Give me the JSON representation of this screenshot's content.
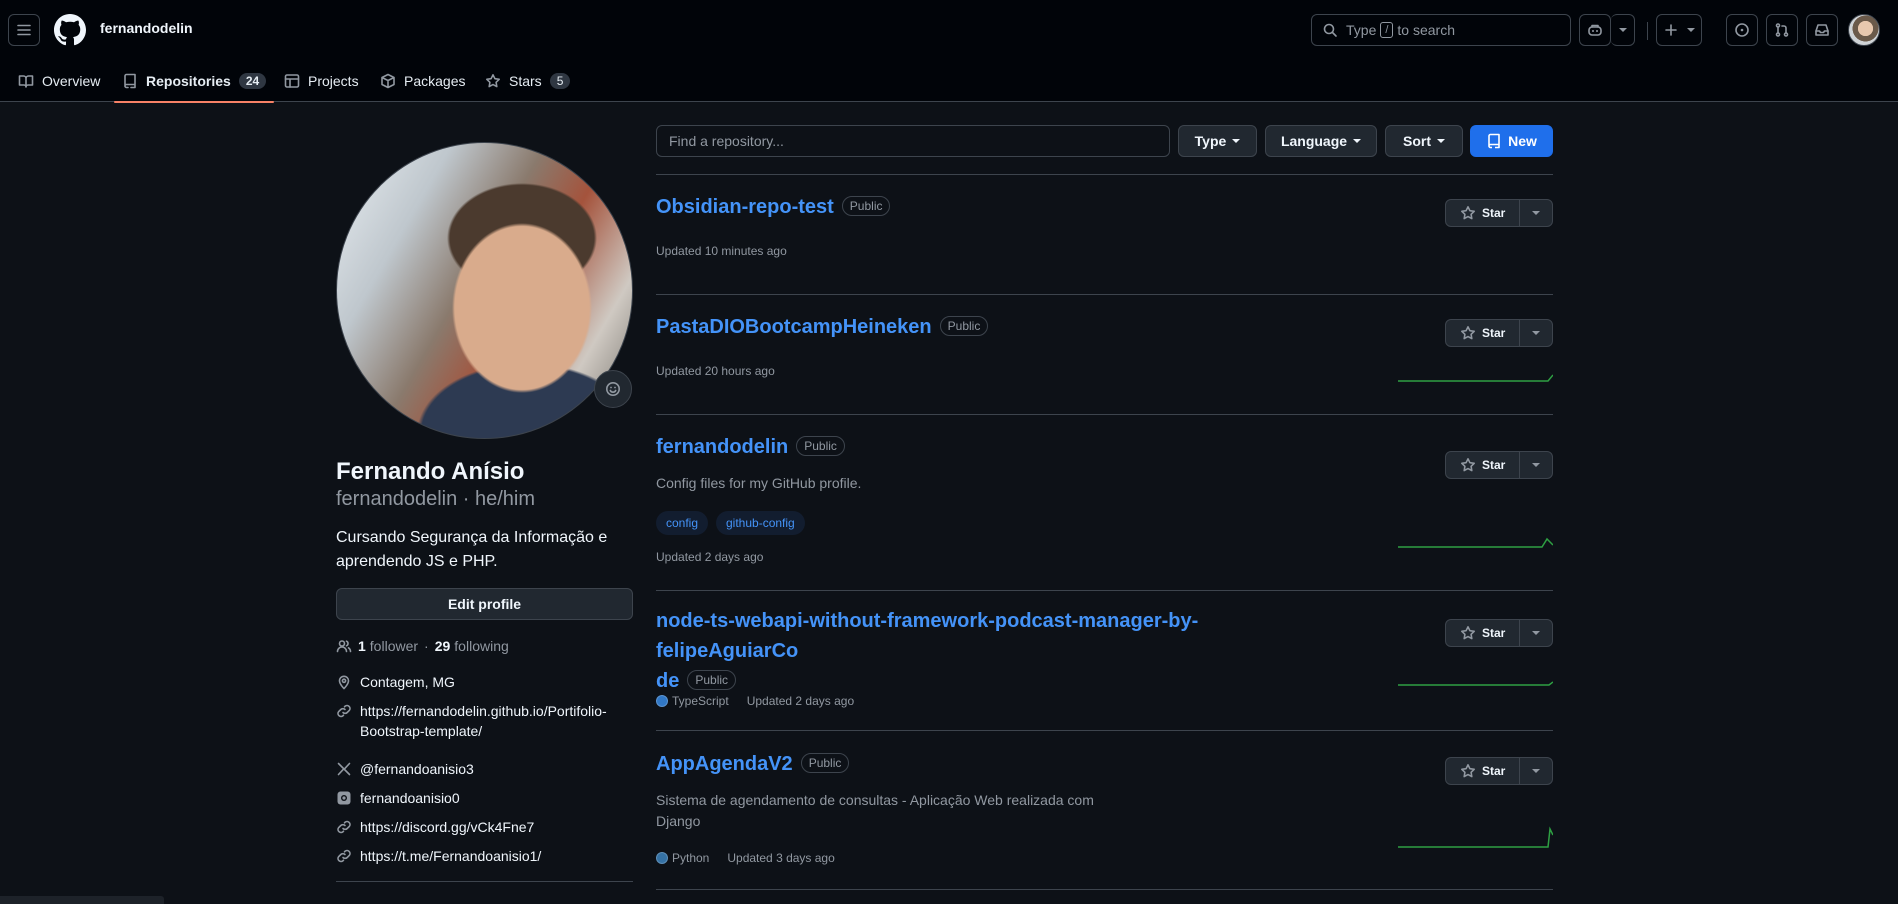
{
  "header": {
    "context": "fernandodelin",
    "search_prefix": "Type",
    "search_key": "/",
    "search_suffix": "to search"
  },
  "tabs": [
    {
      "label": "Overview",
      "icon": "book-icon"
    },
    {
      "label": "Repositories",
      "count": "24",
      "icon": "repo-icon",
      "active": true
    },
    {
      "label": "Projects",
      "icon": "table-icon"
    },
    {
      "label": "Packages",
      "icon": "package-icon"
    },
    {
      "label": "Stars",
      "count": "5",
      "icon": "star-icon"
    }
  ],
  "profile": {
    "name": "Fernando Anísio",
    "login_line": "fernandodelin · he/him",
    "bio": "Cursando Segurança da Informação e aprendendo JS e PHP.",
    "edit_label": "Edit profile",
    "followers": "1",
    "followers_word": "follower",
    "dot": "·",
    "following": "29",
    "following_word": "following",
    "location": "Contagem, MG",
    "website_line1": "https://fernandodelin.github.io/Portifolio-",
    "website_line2": "Bootstrap-template/",
    "twitter": "@fernandoanisio3",
    "instagram": "fernandoanisio0",
    "discord": "https://discord.gg/vCk4Fne7",
    "telegram": "https://t.me/Fernandoanisio1/"
  },
  "filters": {
    "search_placeholder": "Find a repository...",
    "type_label": "Type",
    "language_label": "Language",
    "sort_label": "Sort",
    "new_label": "New"
  },
  "repos": [
    {
      "name": "Obsidian-repo-test",
      "visibility": "Public",
      "updated": "Updated 10 minutes ago",
      "star_label": "Star"
    },
    {
      "name": "PastaDIOBootcampHeineken",
      "visibility": "Public",
      "updated": "Updated 20 hours ago",
      "star_label": "Star"
    },
    {
      "name": "fernandodelin",
      "visibility": "Public",
      "description": "Config files for my GitHub profile.",
      "topics": [
        "config",
        "github-config"
      ],
      "updated": "Updated 2 days ago",
      "star_label": "Star"
    },
    {
      "name_line1": "node-ts-webapi-without-framework-podcast-manager-by-felipeAguiarCo",
      "name_line2": "de",
      "visibility": "Public",
      "language": "TypeScript",
      "language_color": "#3178c6",
      "updated": "Updated 2 days ago",
      "star_label": "Star"
    },
    {
      "name": "AppAgendaV2",
      "visibility": "Public",
      "description_line1": "Sistema de agendamento de consultas - Aplicação Web realizada com",
      "description_line2": "Django",
      "language": "Python",
      "language_color": "#3572A5",
      "updated": "Updated 3 days ago",
      "star_label": "Star"
    }
  ],
  "colors": {
    "background": "#0d1117",
    "link": "#4493f8",
    "accent_underline": "#f78166",
    "primary_button": "#1f6feb",
    "sparkline": "#2ea043"
  }
}
